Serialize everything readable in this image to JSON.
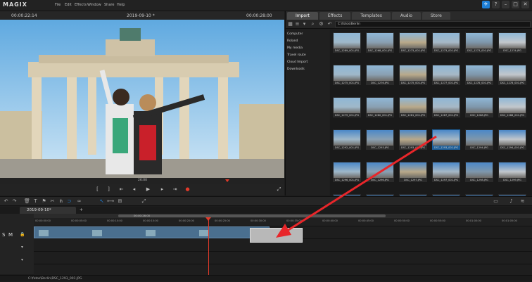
{
  "app": {
    "logo": "MAGIX"
  },
  "menu": [
    "File",
    "Edit",
    "Effects",
    "Window",
    "Share",
    "Help"
  ],
  "preview": {
    "timecode_left": "00:00:22:14",
    "title": "2019-09-10 *",
    "timecode_right": "00:00:28:00",
    "transport_time": "26:00"
  },
  "panel": {
    "tabs": [
      "Import",
      "Effects",
      "Templates",
      "Audio",
      "Store"
    ],
    "active_tab": "Import",
    "path": "C:\\fotos\\Berlin",
    "folders": [
      "Computer",
      "Roland",
      "My media",
      "Travel route",
      "Cloud Import",
      "Downloads"
    ],
    "thumbs": [
      "DSC_1289_001.JPG",
      "DSC_1268_001.JPG",
      "DSC_1273_001.JPG",
      "DSC_1273_001.JPG",
      "DSC_1273_001.JPG",
      "DSC_1274.JPG",
      "DSC_1275_001.JPG",
      "DSC_1276.JPG",
      "DSC_1275_001.JPG",
      "DSC_1277_001.JPG",
      "DSC_1278_001.JPG",
      "DSC_1278_001.JPG",
      "DSC_1279_001.JPG",
      "DSC_1280_001.JPG",
      "DSC_1281_001.JPG",
      "DSC_1287_001.JPG",
      "DSC_1288.JPG",
      "DSC_1288_001.JPG",
      "DSC_1292_001.JPG",
      "DSC_1293.JPG",
      "DSC_1293_001.JPG",
      "DSC_1293_001.JPG",
      "DSC_1294.JPG",
      "DSC_1294_001.JPG",
      "DSC_1296_001.JPG",
      "DSC_1296.JPG",
      "DSC_1297.JPG",
      "DSC_1297_001.JPG",
      "DSC_1298.JPG",
      "DSC_1299.JPG",
      "",
      "",
      "",
      "",
      "",
      ""
    ],
    "selected_index": 21
  },
  "timeline": {
    "tab": "2019-09-10*",
    "ruler_top": "00:00:26:00",
    "ticks": [
      "00:00:00:00",
      "00:00:05:00",
      "00:00:10:00",
      "00:00:15:00",
      "00:00:20:00",
      "00:00:25:00",
      "00:00:30:00",
      "00:00:35:00",
      "00:00:40:00",
      "00:00:45:00",
      "00:00:50:00",
      "00:00:55:00",
      "00:01:00:00",
      "00:01:05:00"
    ],
    "track_labels": [
      "S",
      "M"
    ]
  },
  "status": {
    "path": "C:\\fotos\\Berlin\\DSC_1293_001.JPG"
  },
  "colors": {
    "accent": "#1e7fd6",
    "playhead": "#e23a2a",
    "arrow": "#e8262a"
  }
}
